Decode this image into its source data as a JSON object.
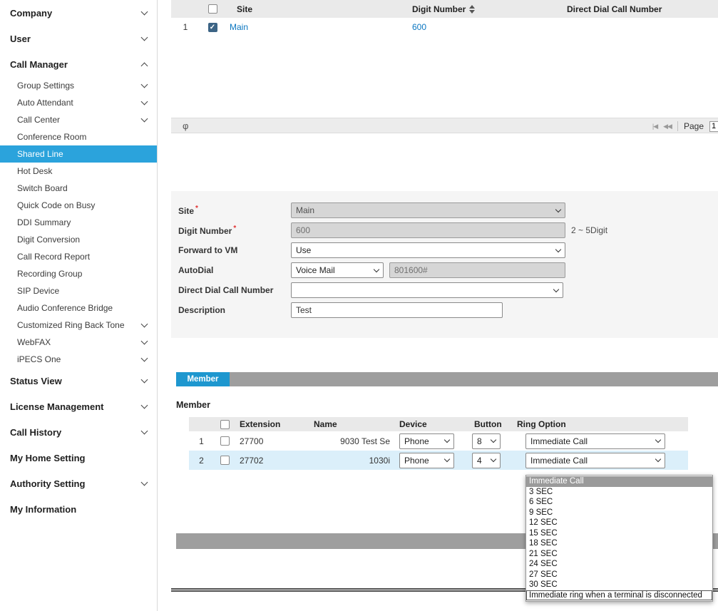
{
  "colors": {
    "accent": "#2ba3dc",
    "link": "#0a76c0",
    "tab": "#1e97cf",
    "bar": "#9e9e9e",
    "row-hl": "#dbeffa",
    "disabled-bg": "#d6d6d6",
    "hl-item": "#9a9a9a"
  },
  "sidebar": {
    "items": [
      {
        "label": "Company",
        "level": 0,
        "chevron": "down"
      },
      {
        "label": "User",
        "level": 0,
        "chevron": "down"
      },
      {
        "label": "Call Manager",
        "level": 0,
        "chevron": "up",
        "expanded": true
      },
      {
        "label": "Group Settings",
        "level": 1,
        "chevron": "down"
      },
      {
        "label": "Auto Attendant",
        "level": 1,
        "chevron": "down"
      },
      {
        "label": "Call Center",
        "level": 1,
        "chevron": "down"
      },
      {
        "label": "Conference Room",
        "level": 1
      },
      {
        "label": "Shared Line",
        "level": 1,
        "selected": true
      },
      {
        "label": "Hot Desk",
        "level": 1
      },
      {
        "label": "Switch Board",
        "level": 1
      },
      {
        "label": "Quick Code on Busy",
        "level": 1
      },
      {
        "label": "DDI Summary",
        "level": 1
      },
      {
        "label": "Digit Conversion",
        "level": 1
      },
      {
        "label": "Call Record Report",
        "level": 1
      },
      {
        "label": "Recording Group",
        "level": 1
      },
      {
        "label": "SIP Device",
        "level": 1
      },
      {
        "label": "Audio Conference Bridge",
        "level": 1
      },
      {
        "label": "Customized Ring Back Tone",
        "level": 1,
        "chevron": "down"
      },
      {
        "label": "WebFAX",
        "level": 1,
        "chevron": "down"
      },
      {
        "label": "iPECS One",
        "level": 1,
        "chevron": "down"
      },
      {
        "label": "Status View",
        "level": 0,
        "chevron": "down"
      },
      {
        "label": "License Management",
        "level": 0,
        "chevron": "down"
      },
      {
        "label": "Call History",
        "level": 0,
        "chevron": "down"
      },
      {
        "label": "My Home Setting",
        "level": 0
      },
      {
        "label": "Authority Setting",
        "level": 0,
        "chevron": "down"
      },
      {
        "label": "My Information",
        "level": 0
      }
    ]
  },
  "site_table": {
    "headers": {
      "site": "Site",
      "digit_number": "Digit Number",
      "direct_dial": "Direct Dial Call Number"
    },
    "rows": [
      {
        "index": "1",
        "checked": true,
        "site": "Main",
        "digit_number": "600",
        "direct_dial": ""
      }
    ]
  },
  "toolbar": {
    "refresh_icon": "φ",
    "pager_first_icon": "|◀",
    "pager_prev_icon": "◀◀",
    "page_label": "Page",
    "page_value": "1"
  },
  "form": {
    "required_marker": "*",
    "site": {
      "label": "Site",
      "value": "Main",
      "required": true,
      "disabled": true
    },
    "digit_number": {
      "label": "Digit Number",
      "value": "600",
      "required": true,
      "disabled": true,
      "hint": "2 ~ 5Digit"
    },
    "forward_to_vm": {
      "label": "Forward to VM",
      "value": "Use"
    },
    "autodial": {
      "label": "AutoDial",
      "mode": "Voice Mail",
      "number": "801600#",
      "number_disabled": true
    },
    "direct_dial": {
      "label": "Direct Dial Call Number",
      "value": ""
    },
    "description": {
      "label": "Description",
      "value": "Test"
    }
  },
  "member": {
    "tab_label": "Member",
    "heading": "Member",
    "headers": {
      "extension": "Extension",
      "name": "Name",
      "device": "Device",
      "button": "Button",
      "ring_option": "Ring Option"
    },
    "rows": [
      {
        "index": "1",
        "checked": false,
        "extension": "27700",
        "name": "9030 Test Se",
        "device": "Phone",
        "button": "8",
        "ring_option": "Immediate Call",
        "highlighted": false
      },
      {
        "index": "2",
        "checked": false,
        "extension": "27702",
        "name": "1030i",
        "device": "Phone",
        "button": "4",
        "ring_option": "Immediate Call",
        "highlighted": true
      }
    ],
    "ring_options": [
      "Immediate Call",
      "3 SEC",
      "6 SEC",
      "9 SEC",
      "12 SEC",
      "15 SEC",
      "18 SEC",
      "21 SEC",
      "24 SEC",
      "27 SEC",
      "30 SEC",
      "Immediate ring when a terminal is disconnected"
    ],
    "ring_dropdown_selected": "Immediate Call"
  }
}
